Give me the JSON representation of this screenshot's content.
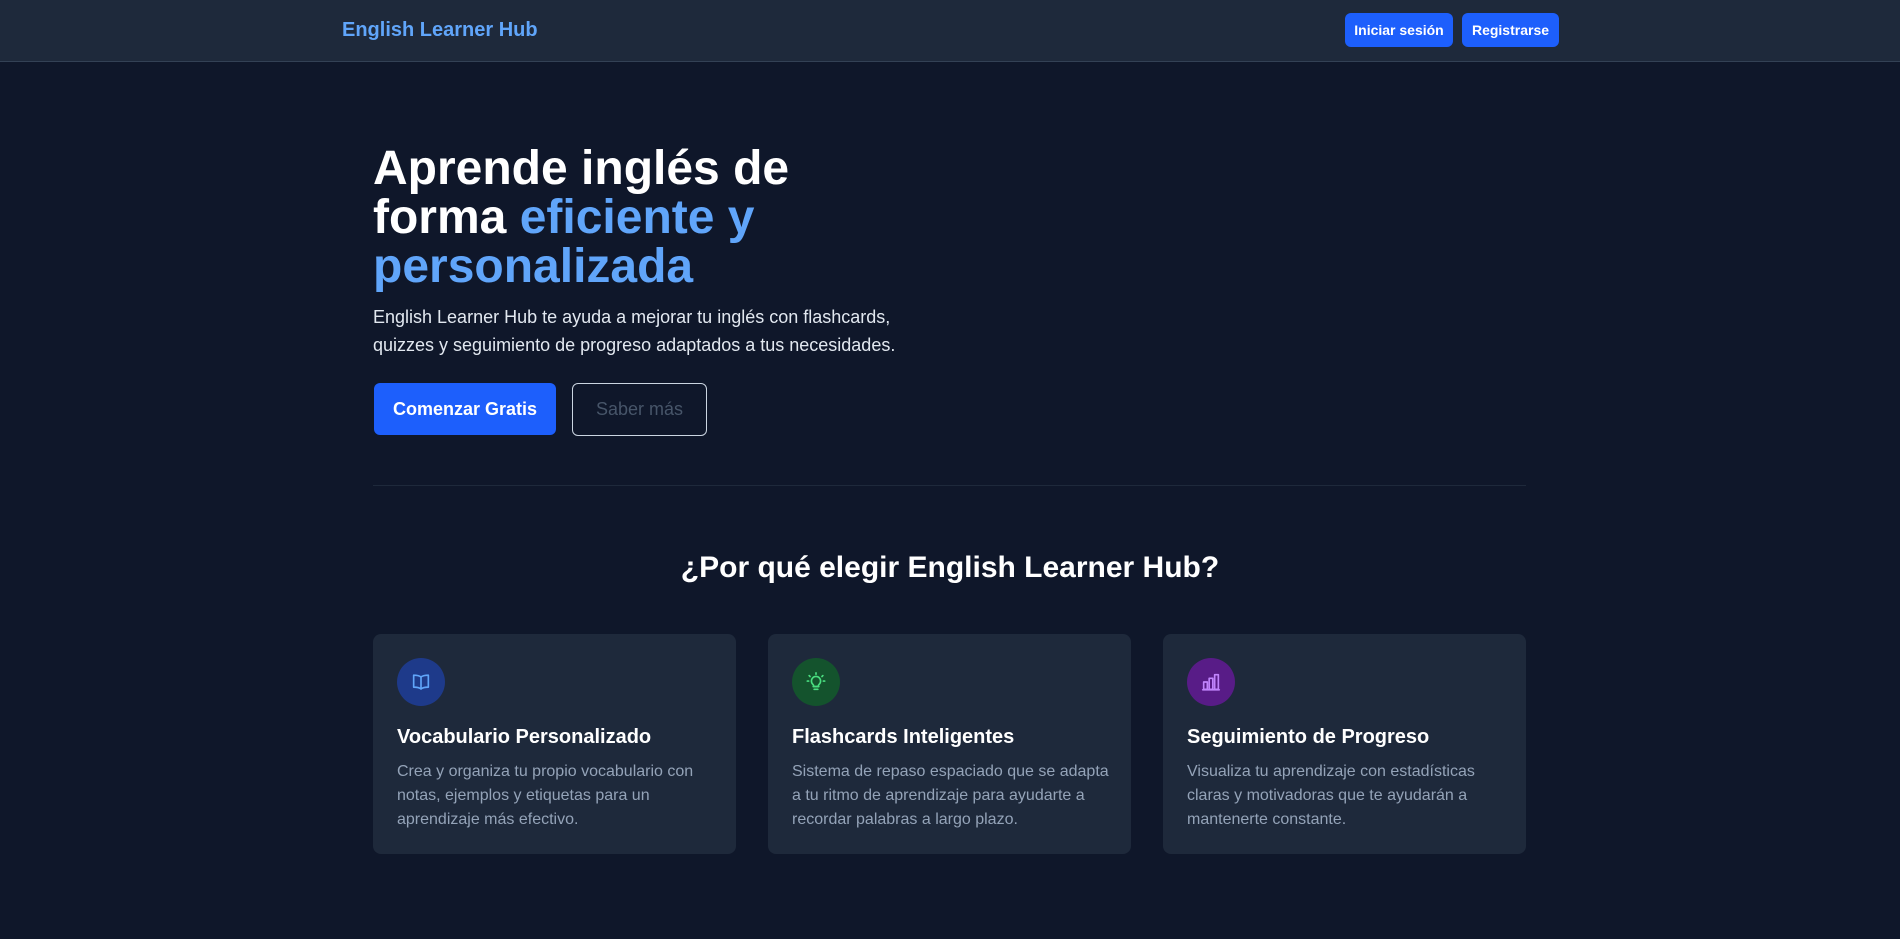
{
  "header": {
    "brand": "English Learner Hub",
    "login_label": "Iniciar sesión",
    "register_label": "Registrarse"
  },
  "hero": {
    "title_part1": "Aprende inglés de forma ",
    "title_accent": "eficiente y personalizada",
    "subtitle": "English Learner Hub te ayuda a mejorar tu inglés con flashcards, quizzes y seguimiento de progreso adaptados a tus necesidades.",
    "primary_cta": "Comenzar Gratis",
    "secondary_cta": "Saber más"
  },
  "features": {
    "title": "¿Por qué elegir English Learner Hub?",
    "items": [
      {
        "icon": "book-open-icon",
        "icon_color": "#60a5fa",
        "title": "Vocabulario Personalizado",
        "text": "Crea y organiza tu propio vocabulario con notas, ejemplos y etiquetas para un aprendizaje más efectivo."
      },
      {
        "icon": "lightbulb-icon",
        "icon_color": "#4ade80",
        "title": "Flashcards Inteligentes",
        "text": "Sistema de repaso espaciado que se adapta a tu ritmo de aprendizaje para ayudarte a recordar palabras a largo plazo."
      },
      {
        "icon": "bar-chart-icon",
        "icon_color": "#c084fc",
        "title": "Seguimiento de Progreso",
        "text": "Visualiza tu aprendizaje con estadísticas claras y motivadoras que te ayudarán a mantenerte constante."
      }
    ]
  },
  "colors": {
    "background": "#0f172a",
    "surface": "#1e293b",
    "accent": "#60a5fa",
    "primary_button": "#1d5ffc"
  }
}
